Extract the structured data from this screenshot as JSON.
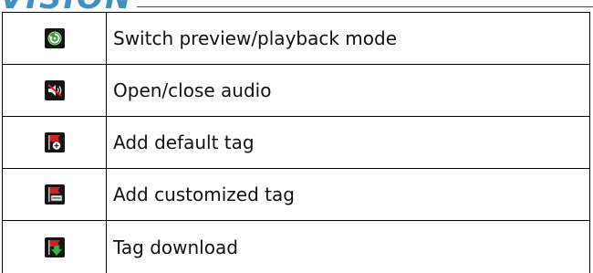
{
  "header": {
    "logo_text": "VISION"
  },
  "rows": [
    {
      "icon": "switch-mode-icon",
      "label": "Switch preview/playback mode"
    },
    {
      "icon": "audio-mute-icon",
      "label": "Open/close audio"
    },
    {
      "icon": "add-default-tag-icon",
      "label": "Add default tag"
    },
    {
      "icon": "add-custom-tag-icon",
      "label": "Add customized tag"
    },
    {
      "icon": "tag-download-icon",
      "label": "Tag download"
    }
  ]
}
